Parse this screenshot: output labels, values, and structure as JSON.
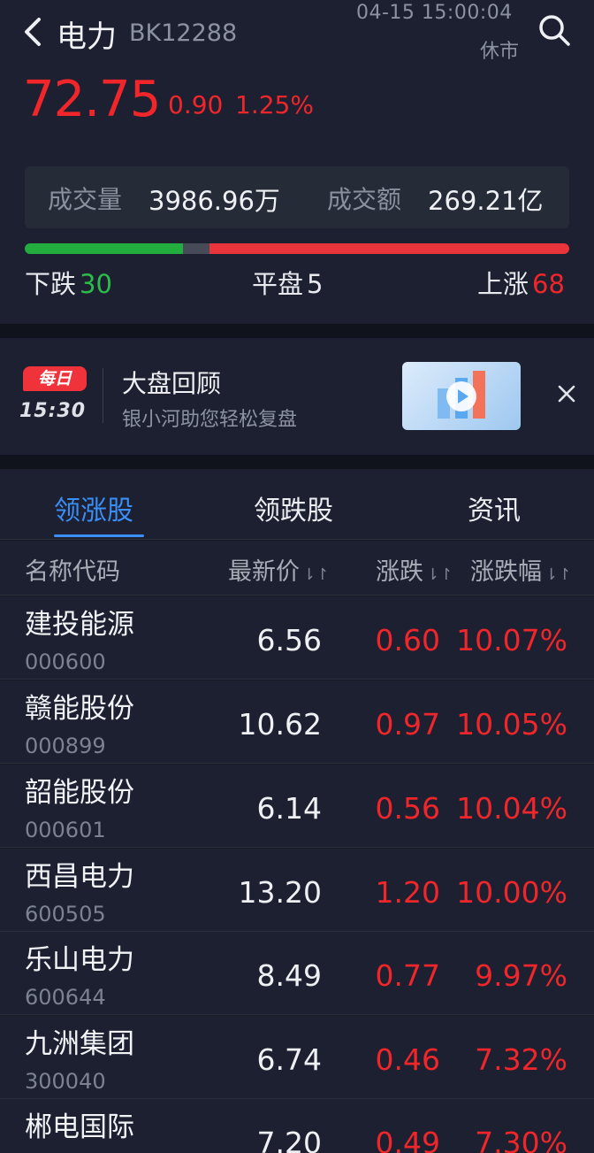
{
  "header": {
    "title": "电力",
    "code": "BK12288",
    "time": "04-15 15:00:04",
    "status": "休市",
    "price": "72.75",
    "change": "0.90",
    "change_pct": "1.25%"
  },
  "volume": {
    "volume_label": "成交量",
    "volume_value": "3986.96万",
    "amount_label": "成交额",
    "amount_value": "269.21亿"
  },
  "breadth": {
    "down_label": "下跌",
    "down_count": "30",
    "flat_label": "平盘",
    "flat_count": "5",
    "up_label": "上涨",
    "up_count": "68",
    "down_fraction": 0.29,
    "flat_fraction": 0.05,
    "up_fraction": 0.66,
    "colors": {
      "down": "#24ad3f",
      "flat": "#464b57",
      "up": "#e8343a"
    }
  },
  "promo": {
    "badge": "每日",
    "badge_time": "15:30",
    "title": "大盘回顾",
    "subtitle": "银小河助您轻松复盘",
    "thumbnail_icon": "video-play-icon",
    "close_icon": "close-icon"
  },
  "tabs": [
    {
      "label": "领涨股",
      "active": true
    },
    {
      "label": "领跌股",
      "active": false
    },
    {
      "label": "资讯",
      "active": false
    }
  ],
  "columns": {
    "name": "名称代码",
    "price": "最新价",
    "change": "涨跌",
    "change_pct": "涨跌幅",
    "sort_icon": "⇂↾"
  },
  "rows": [
    {
      "name": "建投能源",
      "code": "000600",
      "price": "6.56",
      "change": "0.60",
      "change_pct": "10.07%"
    },
    {
      "name": "赣能股份",
      "code": "000899",
      "price": "10.62",
      "change": "0.97",
      "change_pct": "10.05%"
    },
    {
      "name": "韶能股份",
      "code": "000601",
      "price": "6.14",
      "change": "0.56",
      "change_pct": "10.04%"
    },
    {
      "name": "西昌电力",
      "code": "600505",
      "price": "13.20",
      "change": "1.20",
      "change_pct": "10.00%"
    },
    {
      "name": "乐山电力",
      "code": "600644",
      "price": "8.49",
      "change": "0.77",
      "change_pct": "9.97%"
    },
    {
      "name": "九洲集团",
      "code": "300040",
      "price": "6.74",
      "change": "0.46",
      "change_pct": "7.32%"
    },
    {
      "name": "郴电国际",
      "code": "",
      "price": "7.20",
      "change": "0.49",
      "change_pct": "7.30%"
    }
  ],
  "colors": {
    "accent": "#3a8ef6",
    "up": "#f0262b",
    "down": "#2dbb4a"
  }
}
